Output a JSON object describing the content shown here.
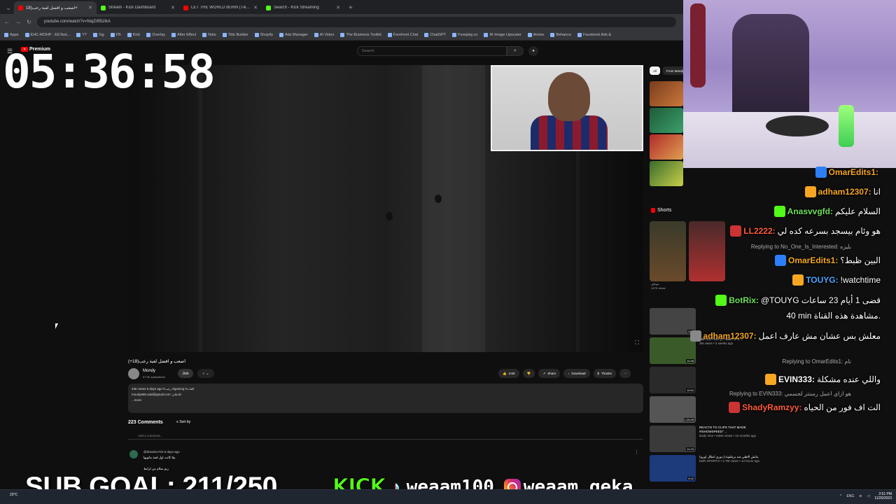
{
  "browser": {
    "tabs": [
      {
        "title": "اصعب و افضل لعبة رعب(18+",
        "active": true,
        "favicon_color": "#ff0000"
      },
      {
        "title": "Stream - Kick Dashboard",
        "active": false,
        "favicon_color": "#53fc18"
      },
      {
        "title": "LET THE WORLD BURN (TikTok",
        "active": false,
        "favicon_color": "#ff0000"
      },
      {
        "title": "Search - Kick Streaming",
        "active": false,
        "favicon_color": "#53fc18"
      }
    ],
    "url": "youtube.com/watch?v=NiqZrB5zIkA",
    "bookmarks": [
      "Apps",
      "EHC-MOHP - EETest...",
      "YT",
      "Gg",
      "FB",
      "Kick",
      "Overlay",
      "After Effect",
      "Note",
      "Title Builder",
      "Shopify",
      "Ads Manager",
      "AI Video",
      "The Business Toolkit",
      "Forefront Chat",
      "ChatGPT",
      "Foreplay.co",
      "AI Image Upscaler",
      "Anime",
      "Behance",
      "Facebook Ads &"
    ]
  },
  "youtube": {
    "brand": "Premium",
    "search_placeholder": "Search",
    "video_title": "اصعب و افضل لعبة رعب(18+)",
    "channel_name": "Mondy",
    "channel_subs": "97.9K subscribers",
    "join_label": "Join",
    "actions": {
      "likes": "3.6K",
      "share": "Share",
      "download": "Download",
      "thanks": "Thanks"
    },
    "description": {
      "line1": "43K views  6 days ago  #رعب #gaming #العاب",
      "line2": "moody585.said@gmail.com :للاعلان",
      "line3": "...more"
    },
    "comments_count": "223 Comments",
    "sort_by": "Sort by",
    "add_comment": "Add a comment...",
    "comment": {
      "author": "@dreamio724  6 days ago",
      "text": "بيلا كانت اول لعبة ماتوبها",
      "text2": "ريم سلام من لرابط"
    },
    "chips": [
      "All",
      "From Mondy"
    ],
    "shorts_label": "Shorts",
    "short_meta": {
      "title": "مونكوز",
      "views": "147K views"
    },
    "recs": [
      {
        "title": "",
        "sub": "",
        "duration": "5:54"
      },
      {
        "title": "USA EDITION (ft. Adam W & ...",
        "sub": "2M views • 2 weeks ago",
        "duration": "10:48"
      },
      {
        "title": "",
        "sub": "",
        "duration": "10:54"
      },
      {
        "title": "",
        "sub": "",
        "duration": "1:26:08"
      },
      {
        "title": "REACTS TO CLIPS THAT MADE #ISHOWSPEED\" ...",
        "sub": "Daily Vine • 646K views • 10 months ago",
        "duration": "11:23"
      },
      {
        "title": "ماتش الاهلي ضد برشلونة | دوري ابطال اوروبا",
        "sub": "beIN SPORTS • 2.7M views • 14 hours ago",
        "duration": "8:42"
      }
    ]
  },
  "overlay": {
    "timer": "05:36:58",
    "sub_goal": "SUB GOAL: 211/250",
    "kick_logo": "KICK",
    "tiktok_handle": "weaam100",
    "instagram_handle": "weaam_geka"
  },
  "chat": [
    {
      "user": "OmarEdits1:",
      "text": "",
      "color": "#f5a623"
    },
    {
      "user": "adham12307:",
      "text": "انا",
      "color": "#f5a623"
    },
    {
      "user": "Anasvvgfd:",
      "text": "السلام عليكم",
      "color": "#6ee05a"
    },
    {
      "user": "LL2222:",
      "text": "هو وئام بيسجد بسرعه كده لي",
      "color": "#ff5a3a"
    },
    {
      "reply": "Replying to No_One_Is_Interested: بليزه"
    },
    {
      "user": "OmarEdits1:",
      "text": "البين ظبط؟",
      "color": "#f5a623"
    },
    {
      "user": "TOUYG:",
      "text": "!watchtime",
      "color": "#4da6ff"
    },
    {
      "user": "BotRix:",
      "text": "@TOUYG قضى 1 أيام 23 ساعات",
      "color": "#6ee05a"
    },
    {
      "user": "",
      "text": "40 min مشاهدة هذه القناة.",
      "color": "#ffffff"
    },
    {
      "user": "adham12307:",
      "text": "معلش بس عشان مش عارف اعمل",
      "color": "#f5a623"
    },
    {
      "reply": "Replying to OmarEdits1: نام"
    },
    {
      "user": "EVIN333:",
      "text": "واللي عنده مشكلة",
      "color": "#ffffff"
    },
    {
      "reply": "Replying to EVIN333: هو ازاي اعمل رسنتر لجسمي"
    },
    {
      "user": "ShadyRamzyy:",
      "text": "الت اف فور من الحياه",
      "color": "#ff5a3a"
    }
  ],
  "taskbar": {
    "weather": "23°C",
    "lang": "ENG",
    "time": "2:51 PM",
    "date": "11/26/2023"
  }
}
